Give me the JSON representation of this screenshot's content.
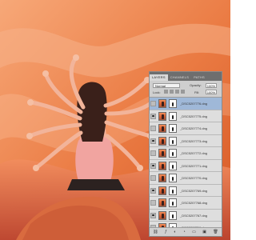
{
  "canvas": {
    "bg_light": "#f7a878",
    "bg_mid": "#ea7a42",
    "bg_dark": "#d55725"
  },
  "layers_panel": {
    "tabs": [
      "LAYERS",
      "CHANNELS",
      "PATHS"
    ],
    "blend_mode": "Normal",
    "opacity_label": "Opacity:",
    "opacity_value": "100%",
    "lock_label": "Lock:",
    "fill_label": "Fill:",
    "fill_value": "100%",
    "layers": [
      {
        "name": "_DSC5207776.dng",
        "selected": true,
        "visible": false
      },
      {
        "name": "_DSC5207775.dng",
        "selected": false,
        "visible": true
      },
      {
        "name": "_DSC5207774.dng",
        "selected": false,
        "visible": false
      },
      {
        "name": "_DSC5207773.dng",
        "selected": false,
        "visible": true
      },
      {
        "name": "_DSC5207772.dng",
        "selected": false,
        "visible": false
      },
      {
        "name": "_DSC5207771.dng",
        "selected": false,
        "visible": true
      },
      {
        "name": "_DSC5207770.dng",
        "selected": false,
        "visible": false
      },
      {
        "name": "_DSC5207769.dng",
        "selected": false,
        "visible": true
      },
      {
        "name": "_DSC5207768.dng",
        "selected": false,
        "visible": false
      },
      {
        "name": "_DSC5207767.dng",
        "selected": false,
        "visible": true
      },
      {
        "name": "_DSC5207766.dng",
        "selected": false,
        "visible": false
      }
    ],
    "footer_icons": [
      "link-icon",
      "fx-icon",
      "mask-icon",
      "adjustment-icon",
      "group-icon",
      "new-layer-icon",
      "trash-icon"
    ]
  }
}
